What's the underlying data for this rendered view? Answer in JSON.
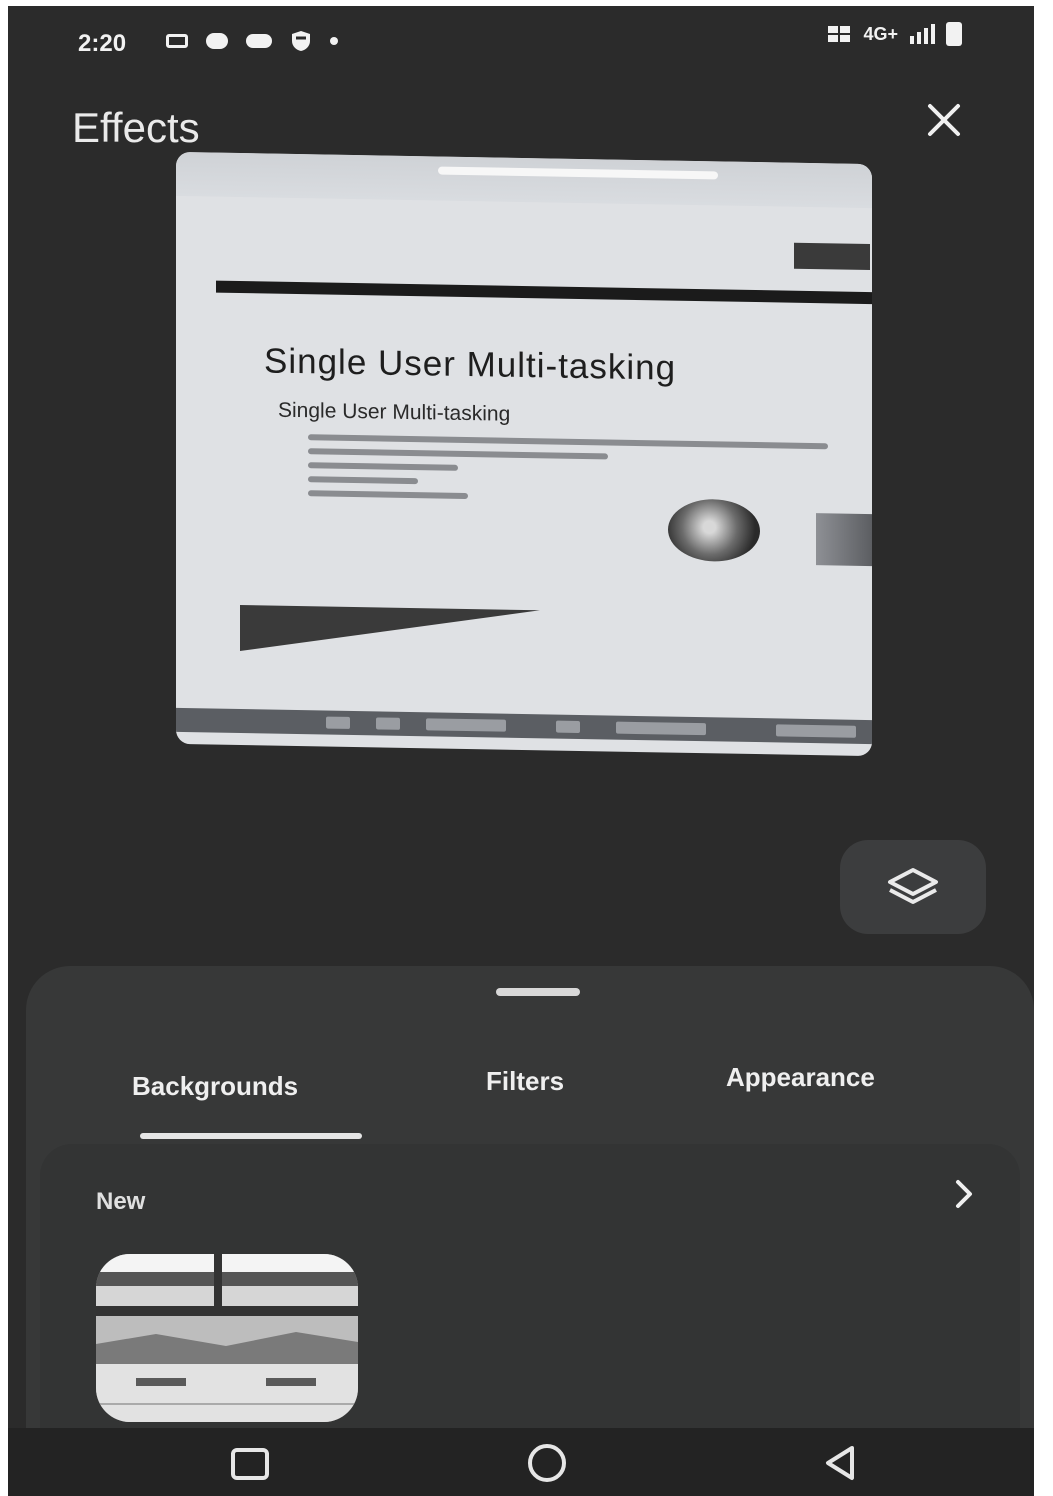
{
  "status_bar": {
    "time": "2:20",
    "network": "4G+",
    "left_icons": [
      "camera-icon",
      "chat-icon",
      "jio-icon",
      "shield-icon",
      "dot-icon"
    ],
    "right_icons": [
      "volte-icon",
      "signal-icon",
      "battery-icon"
    ]
  },
  "header": {
    "title": "Effects",
    "close_icon": "close-icon"
  },
  "preview": {
    "slide_heading": "Single User Multi-tasking",
    "slide_subheading": "Single User Multi-tasking",
    "mute_icon": "microphone-muted-icon"
  },
  "layers_button": {
    "icon": "layers-icon"
  },
  "tabs": [
    {
      "label": "Backgrounds",
      "selected": true
    },
    {
      "label": "Filters",
      "selected": false
    },
    {
      "label": "Appearance",
      "selected": false
    }
  ],
  "section": {
    "title": "New",
    "more_icon": "chevron-right-icon"
  },
  "navigation": [
    "recents-icon",
    "home-icon",
    "back-icon"
  ],
  "colors": {
    "background": "#2b2b2b",
    "sheet": "#373838",
    "text": "#efefef"
  }
}
